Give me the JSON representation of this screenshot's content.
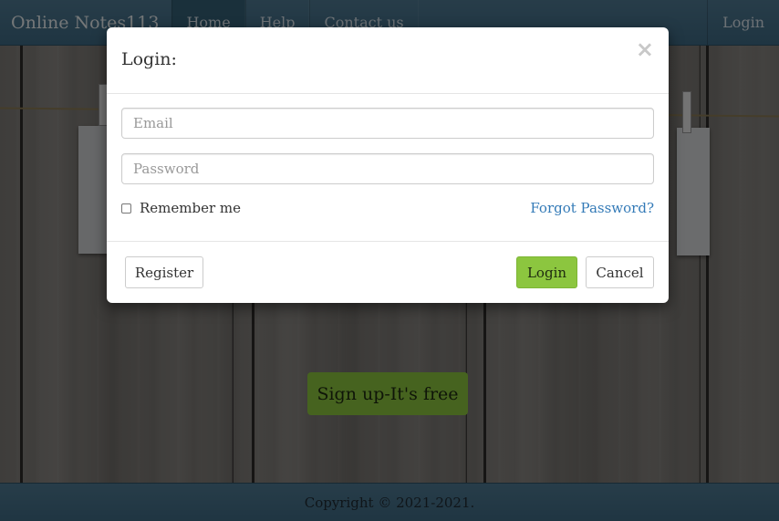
{
  "navbar": {
    "brand": "Online Notes113",
    "items": [
      {
        "label": "Home",
        "active": true
      },
      {
        "label": "Help",
        "active": false
      },
      {
        "label": "Contact us",
        "active": false
      }
    ],
    "login": "Login"
  },
  "hero": {
    "signup_label": "Sign up-It's free"
  },
  "footer": {
    "copyright": "Copyright © 2021-2021."
  },
  "modal": {
    "title": "Login:",
    "close_glyph": "×",
    "email_placeholder": "Email",
    "password_placeholder": "Password",
    "remember_label": "Remember me",
    "remember_checked": false,
    "forgot_label": "Forgot Password?",
    "register_label": "Register",
    "login_label": "Login",
    "cancel_label": "Cancel"
  },
  "colors": {
    "accent_green": "#8cc63f",
    "navbar_blue": "#4f7a93",
    "link_blue": "#337ab7"
  }
}
